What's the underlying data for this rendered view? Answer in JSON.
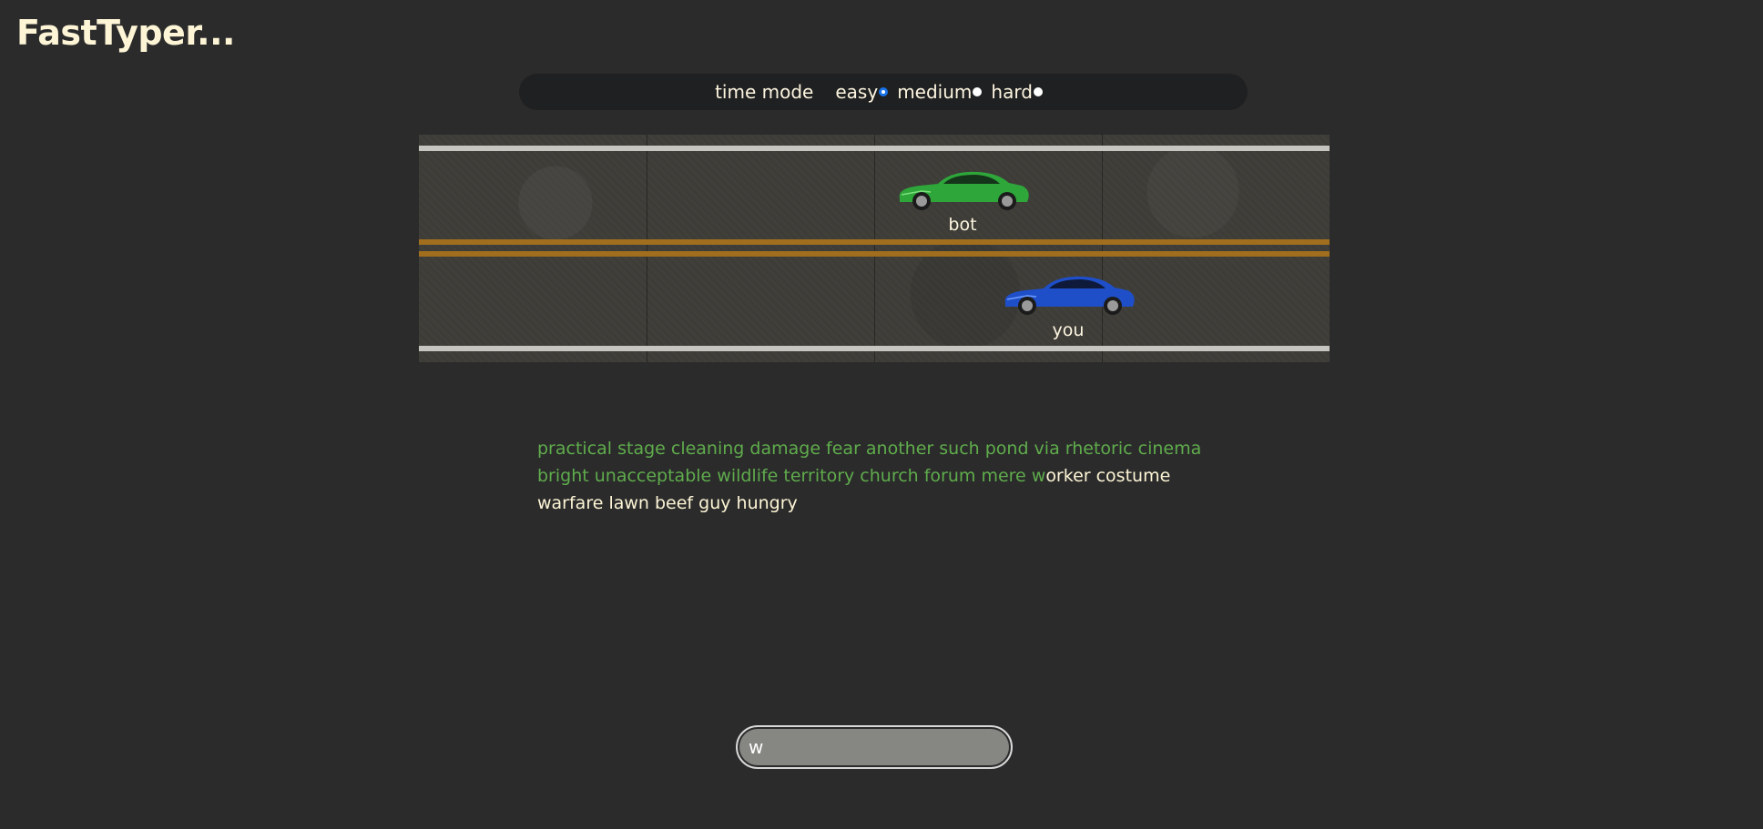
{
  "app": {
    "title": "FastTyper..."
  },
  "mode_bar": {
    "label": "time mode",
    "options": [
      {
        "label": "easy",
        "selected": true
      },
      {
        "label": "medium",
        "selected": false
      },
      {
        "label": "hard",
        "selected": false
      }
    ]
  },
  "race": {
    "bot": {
      "label": "bot",
      "color": "#2ea63a"
    },
    "player": {
      "label": "you",
      "color": "#1f4fc8"
    }
  },
  "words": {
    "typed": "practical stage cleaning damage fear another such pond via rhetoric cinema bright unacceptable wildlife territory church forum mere w",
    "remaining": "orker costume warfare lawn beef guy hungry"
  },
  "input": {
    "value": "w"
  },
  "colors": {
    "background": "#2b2b2b",
    "typed_text": "#5fac4c",
    "untyped_text": "#fdf5d6",
    "selected_radio": "#1a73e8"
  }
}
